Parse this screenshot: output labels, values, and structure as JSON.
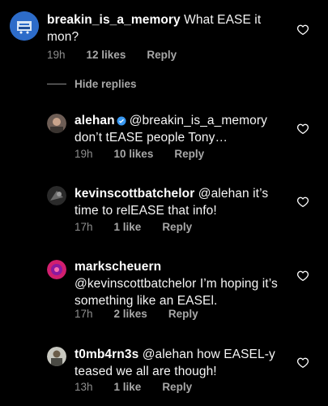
{
  "comments": [
    {
      "username": "breakin_is_a_memory",
      "text": " What EASE it mon?",
      "time": "19h",
      "likes": "12 likes",
      "reply": "Reply",
      "avatar_icon": "avatar-blue-circle"
    },
    {
      "username": "alehan",
      "verified": true,
      "text": "@breakin_is_a_memory don’t tEASE people Tony…",
      "time": "19h",
      "likes": "10 likes",
      "reply": "Reply",
      "avatar_icon": "avatar-photo"
    },
    {
      "username": "kevinscottbatchelor",
      "text": " @alehan it’s time to relEASE that info!",
      "time": "17h",
      "likes": "1 like",
      "reply": "Reply",
      "avatar_icon": "avatar-photo"
    },
    {
      "username": "markscheuern",
      "text": "@kevinscottbatchelor I’m hoping it’s something like an EASEl.",
      "time": "17h",
      "likes": "2 likes",
      "reply": "Reply",
      "avatar_icon": "avatar-pink"
    },
    {
      "username": "t0mb4rn3s",
      "text": " @alehan how EASEL-y teased we all are though!",
      "time": "13h",
      "likes": "1 like",
      "reply": "Reply",
      "avatar_icon": "avatar-photo"
    }
  ],
  "hide_replies_label": "Hide replies",
  "colors": {
    "background": "#000000",
    "meta_text": "#8e8e8e",
    "verified_blue": "#3897f0"
  }
}
